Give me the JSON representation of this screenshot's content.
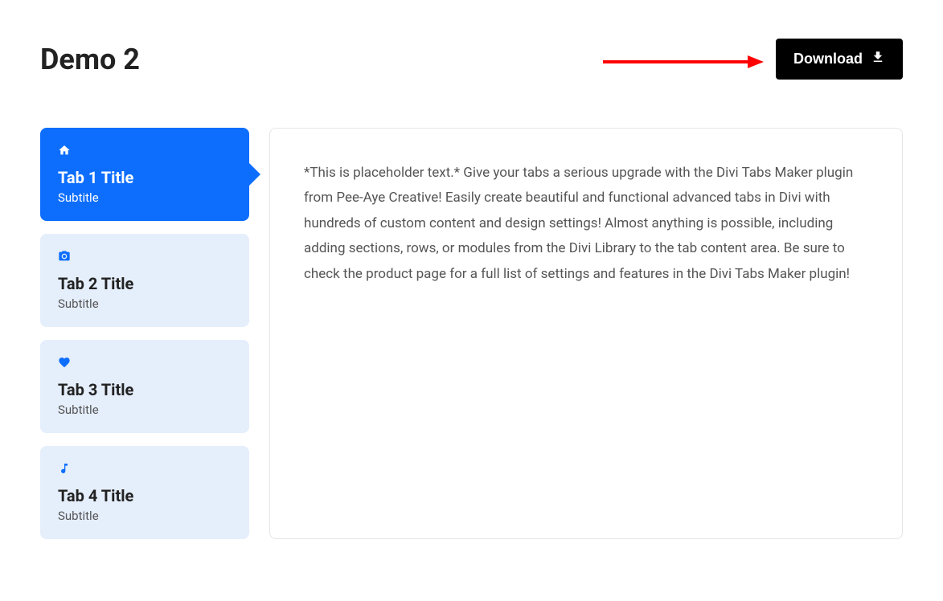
{
  "header": {
    "title": "Demo 2",
    "download_button_label": "Download"
  },
  "tabs": [
    {
      "icon": "home-icon",
      "title": "Tab 1 Title",
      "subtitle": "Subtitle",
      "active": true
    },
    {
      "icon": "camera-icon",
      "title": "Tab 2 Title",
      "subtitle": "Subtitle",
      "active": false
    },
    {
      "icon": "heart-icon",
      "title": "Tab 3 Title",
      "subtitle": "Subtitle",
      "active": false
    },
    {
      "icon": "music-icon",
      "title": "Tab 4 Title",
      "subtitle": "Subtitle",
      "active": false
    }
  ],
  "content": {
    "body": "*This is placeholder text.* Give your tabs a serious upgrade with the Divi Tabs Maker plugin from Pee-Aye Creative! Easily create beautiful and functional advanced tabs in Divi with hundreds of custom content and design settings! Almost anything is possible, including adding sections, rows, or modules from the Divi Library to the tab content area. Be sure to check the product page for a full list of settings and features in the Divi Tabs Maker plugin!"
  },
  "annotation": {
    "arrow_color": "#ff0000"
  }
}
